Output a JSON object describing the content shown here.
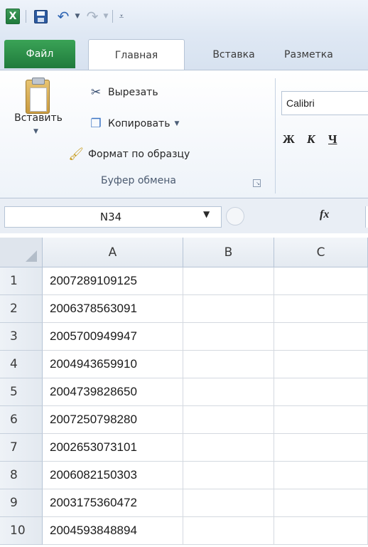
{
  "app": {
    "logo_letter": "X",
    "accent_green": "#1f7a3c"
  },
  "qat": {
    "icons": [
      "excel-icon",
      "save-icon",
      "undo-icon",
      "redo-icon",
      "customize-icon"
    ]
  },
  "tabs": {
    "file": "Файл",
    "home": "Главная",
    "insert": "Вставка",
    "layout": "Разметка"
  },
  "clipboard": {
    "paste_label": "Вставить",
    "cut_label": "Вырезать",
    "copy_label": "Копировать",
    "format_painter_label": "Формат по образцу",
    "group_label": "Буфер обмена"
  },
  "font": {
    "name": "Calibri",
    "bold_label": "Ж",
    "italic_label": "К",
    "underline_label": "Ч"
  },
  "formula_bar": {
    "name_box": "N34",
    "fx_label": "fx",
    "formula_value": ""
  },
  "sheet": {
    "columns": [
      "A",
      "B",
      "C"
    ],
    "rows": [
      {
        "num": "1",
        "a": "2007289109125",
        "b": "",
        "c": ""
      },
      {
        "num": "2",
        "a": "2006378563091",
        "b": "",
        "c": ""
      },
      {
        "num": "3",
        "a": "2005700949947",
        "b": "",
        "c": ""
      },
      {
        "num": "4",
        "a": "2004943659910",
        "b": "",
        "c": ""
      },
      {
        "num": "5",
        "a": "2004739828650",
        "b": "",
        "c": ""
      },
      {
        "num": "6",
        "a": "2007250798280",
        "b": "",
        "c": ""
      },
      {
        "num": "7",
        "a": "2002653073101",
        "b": "",
        "c": ""
      },
      {
        "num": "8",
        "a": "2006082150303",
        "b": "",
        "c": ""
      },
      {
        "num": "9",
        "a": "2003175360472",
        "b": "",
        "c": ""
      },
      {
        "num": "10",
        "a": "2004593848894",
        "b": "",
        "c": ""
      }
    ]
  }
}
